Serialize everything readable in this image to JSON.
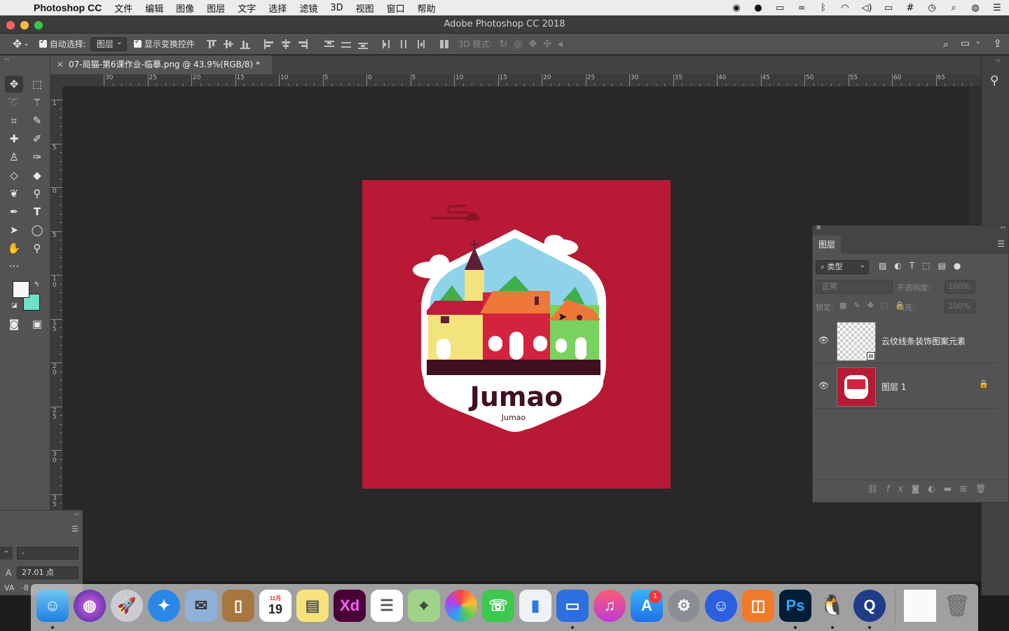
{
  "menubar": {
    "app_name": "Photoshop CC",
    "items": [
      "文件",
      "编辑",
      "图像",
      "图层",
      "文字",
      "选择",
      "滤镜",
      "3D",
      "视图",
      "窗口",
      "帮助"
    ]
  },
  "window": {
    "title": "Adobe Photoshop CC 2018"
  },
  "options_bar": {
    "auto_select_label": "自动选择:",
    "auto_select_value": "图层",
    "show_transform_label": "显示变换控件",
    "mode_3d_label": "3D 模式:"
  },
  "document_tab": {
    "title": "07-局猫-第6课作业-临摹.png @ 43.9%(RGB/8) *"
  },
  "rulers": {
    "h_labels": [
      "30",
      "25",
      "20",
      "15",
      "10",
      "5",
      "0",
      "5",
      "10",
      "15",
      "20",
      "25",
      "30",
      "35",
      "40",
      "45",
      "50",
      "55",
      "60",
      "65"
    ],
    "v_labels": [
      "1",
      "5",
      "0",
      "5",
      "1 0",
      "1 5",
      "2 0",
      "2 5",
      "3 0",
      "3 5"
    ]
  },
  "artwork": {
    "brand_large": "Jumao",
    "brand_small": "Jumao",
    "background_color": "#b81934"
  },
  "layers_panel": {
    "tab_label": "图层",
    "filter_label": "类型",
    "blend_mode": "正常",
    "opacity_label": "不透明度:",
    "opacity_value": "100%",
    "lock_label": "锁定:",
    "fill_label": "填充:",
    "fill_value": "100%",
    "layers": [
      {
        "name": "云纹线条装饰图案元素",
        "locked": false,
        "visible": true
      },
      {
        "name": "图层 1",
        "locked": true,
        "visible": true
      }
    ]
  },
  "character_panel": {
    "font_dropdown": "-",
    "leading_value": "27.01 点",
    "tracking_label": "-8"
  },
  "dock": {
    "badge_app_store": "1",
    "calendar_month": "11月",
    "calendar_day": "19",
    "xd_label": "Xd",
    "ps_label": "Ps"
  }
}
